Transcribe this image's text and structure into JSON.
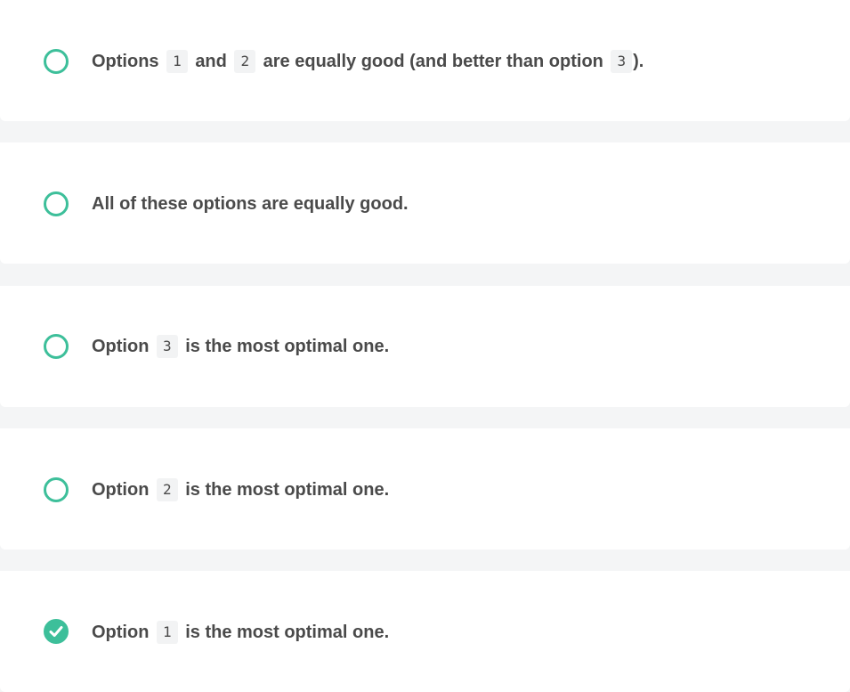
{
  "accent_color": "#3dbf9a",
  "text_color": "#4a4a4a",
  "options": [
    {
      "state": "unselected",
      "icon": "radio-empty-icon",
      "parts": [
        "Options",
        "1",
        "and",
        "2",
        "are equally good (and better than option",
        "3",
        ")."
      ]
    },
    {
      "state": "unselected",
      "icon": "radio-empty-icon",
      "text": "All of these options are equally good."
    },
    {
      "state": "unselected",
      "icon": "radio-empty-icon",
      "parts": [
        "Option",
        "3",
        "is the most optimal one."
      ]
    },
    {
      "state": "unselected",
      "icon": "radio-empty-icon",
      "parts": [
        "Option",
        "2",
        "is the most optimal one."
      ]
    },
    {
      "state": "selected",
      "icon": "check-circle-icon",
      "parts": [
        "Option",
        "1",
        "is the most optimal one."
      ]
    }
  ]
}
